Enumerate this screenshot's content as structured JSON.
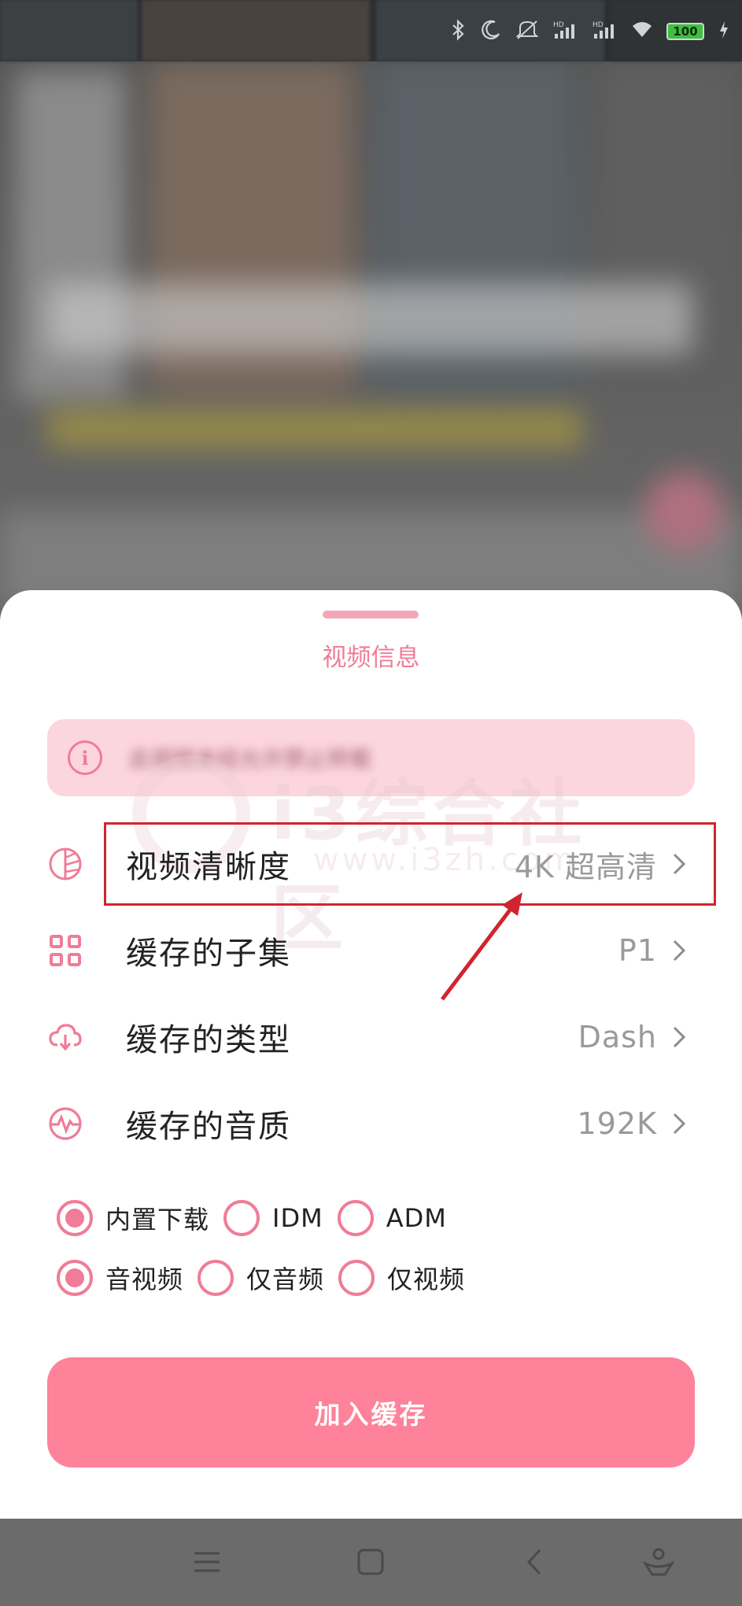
{
  "status_bar": {
    "battery_level": "100",
    "icons": [
      "bluetooth-icon",
      "moon-icon",
      "mute-icon",
      "hd-signal-icon",
      "hd-signal-icon",
      "wifi-icon",
      "battery-icon",
      "charging-icon"
    ]
  },
  "sheet": {
    "title": "视频信息",
    "notice": {
      "icon": "info-icon",
      "text": "此视频未经允许禁止转载"
    },
    "watermark": {
      "text": "i3综合社区",
      "url": "www.i3zh.com"
    },
    "settings": [
      {
        "label": "视频清晰度",
        "value": "4K 超高清",
        "icon": "quality-icon",
        "highlighted": true
      },
      {
        "label": "缓存的子集",
        "value": "P1",
        "icon": "grid-icon",
        "highlighted": false
      },
      {
        "label": "缓存的类型",
        "value": "Dash",
        "icon": "cloud-download-icon",
        "highlighted": false
      },
      {
        "label": "缓存的音质",
        "value": "192K",
        "icon": "audio-wave-icon",
        "highlighted": false
      }
    ],
    "download_options": [
      {
        "label": "内置下载",
        "selected": true
      },
      {
        "label": "IDM",
        "selected": false
      },
      {
        "label": "ADM",
        "selected": false
      }
    ],
    "media_options": [
      {
        "label": "音视频",
        "selected": true
      },
      {
        "label": "仅音频",
        "selected": false
      },
      {
        "label": "仅视频",
        "selected": false
      }
    ],
    "submit_label": "加入缓存"
  },
  "nav_bar": {
    "buttons": [
      "menu-icon",
      "home-icon",
      "back-icon",
      "assistant-icon"
    ]
  },
  "colors": {
    "accent": "#f07c98",
    "button": "#fd829a",
    "notice_bg": "#fcd6df",
    "annotation": "#d0252f"
  }
}
